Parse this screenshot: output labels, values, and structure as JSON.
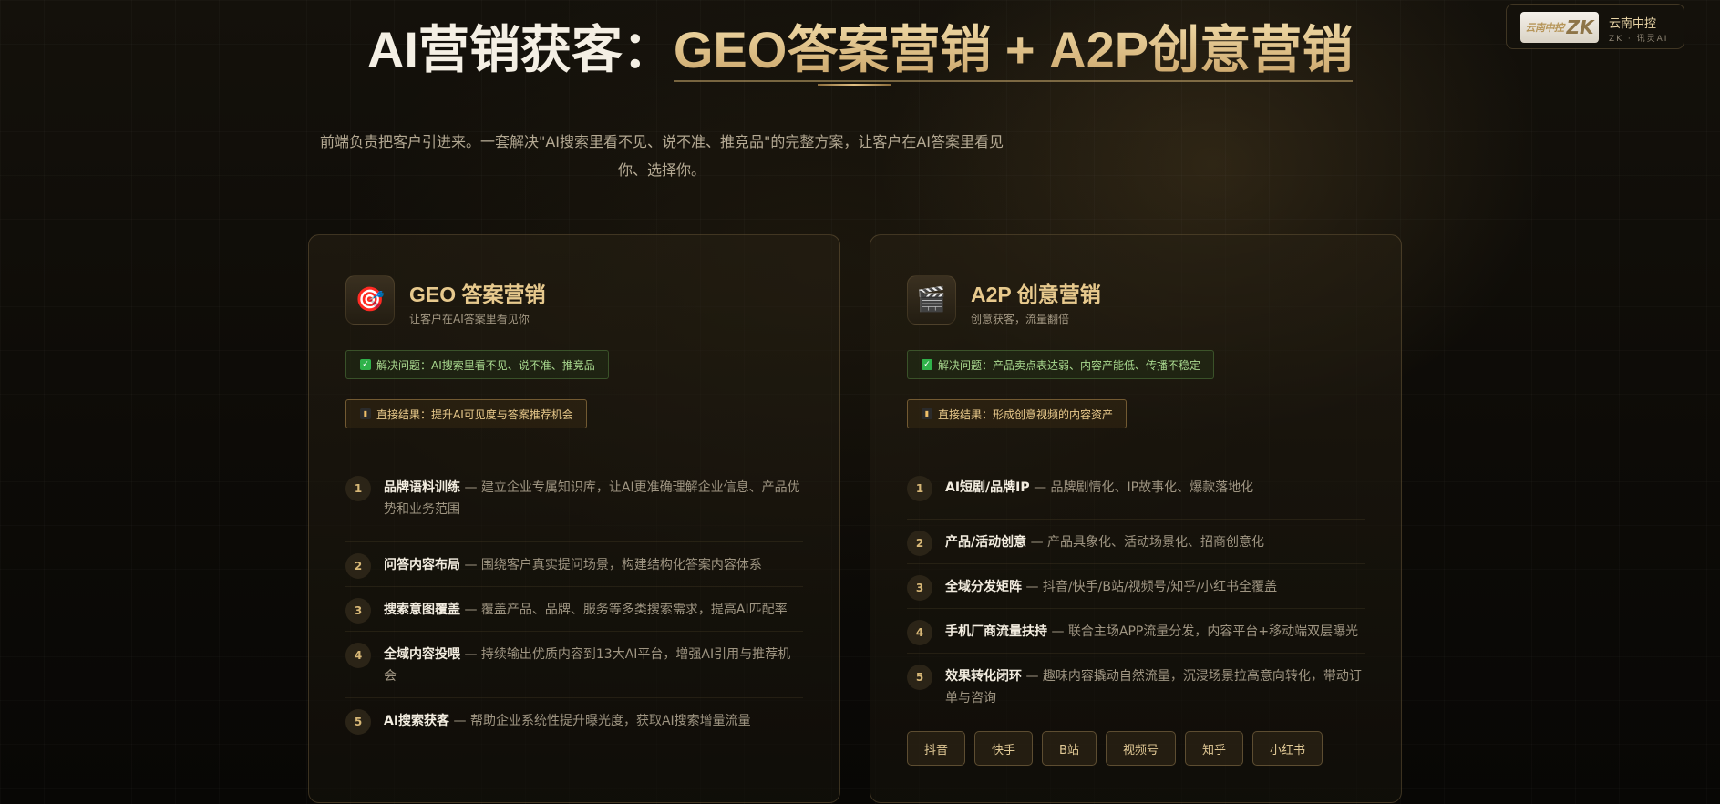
{
  "brand": {
    "logo_text": "云南中控",
    "logo_mark": "ZK",
    "name": "云南中控",
    "tagline": "ZK · 讯灵AI"
  },
  "hero": {
    "title_prefix": "AI营销获客：",
    "title_highlight": "GEO答案营销 + A2P创意营销",
    "subtitle": "前端负责把客户引进来。一套解决\"AI搜索里看不见、说不准、推竞品\"的完整方案，让客户在AI答案里看见你、选择你。"
  },
  "cards": [
    {
      "icon": "target-icon",
      "title": "GEO 答案营销",
      "subtitle": "让客户在AI答案里看见你",
      "problem": "解决问题：AI搜索里看不见、说不准、推竞品",
      "result": "直接结果：提升AI可见度与答案推荐机会",
      "items": [
        {
          "num": "1",
          "title": "品牌语料训练",
          "desc": " — 建立企业专属知识库，让AI更准确理解企业信息、产品优势和业务范围"
        },
        {
          "num": "2",
          "title": "问答内容布局",
          "desc": " — 围绕客户真实提问场景，构建结构化答案内容体系"
        },
        {
          "num": "3",
          "title": "搜索意图覆盖",
          "desc": " — 覆盖产品、品牌、服务等多类搜索需求，提高AI匹配率"
        },
        {
          "num": "4",
          "title": "全域内容投喂",
          "desc": " — 持续输出优质内容到13大AI平台，增强AI引用与推荐机会"
        },
        {
          "num": "5",
          "title": "AI搜索获客",
          "desc": " — 帮助企业系统性提升曝光度，获取AI搜索增量流量"
        }
      ]
    },
    {
      "icon": "clapperboard-icon",
      "title": "A2P 创意营销",
      "subtitle": "创意获客，流量翻倍",
      "problem": "解决问题：产品卖点表达弱、内容产能低、传播不稳定",
      "result": "直接结果：形成创意视频的内容资产",
      "items": [
        {
          "num": "1",
          "title": "AI短剧/品牌IP",
          "desc": " — 品牌剧情化、IP故事化、爆款落地化"
        },
        {
          "num": "2",
          "title": "产品/活动创意",
          "desc": " — 产品具象化、活动场景化、招商创意化"
        },
        {
          "num": "3",
          "title": "全域分发矩阵",
          "desc": " — 抖音/快手/B站/视频号/知乎/小红书全覆盖"
        },
        {
          "num": "4",
          "title": "手机厂商流量扶持",
          "desc": " — 联合主场APP流量分发，内容平台+移动端双层曝光"
        },
        {
          "num": "5",
          "title": "效果转化闭环",
          "desc": " — 趣味内容撬动自然流量，沉浸场景拉高意向转化，带动订单与咨询"
        }
      ],
      "tags": [
        "抖音",
        "快手",
        "B站",
        "视频号",
        "知乎",
        "小红书"
      ]
    }
  ]
}
